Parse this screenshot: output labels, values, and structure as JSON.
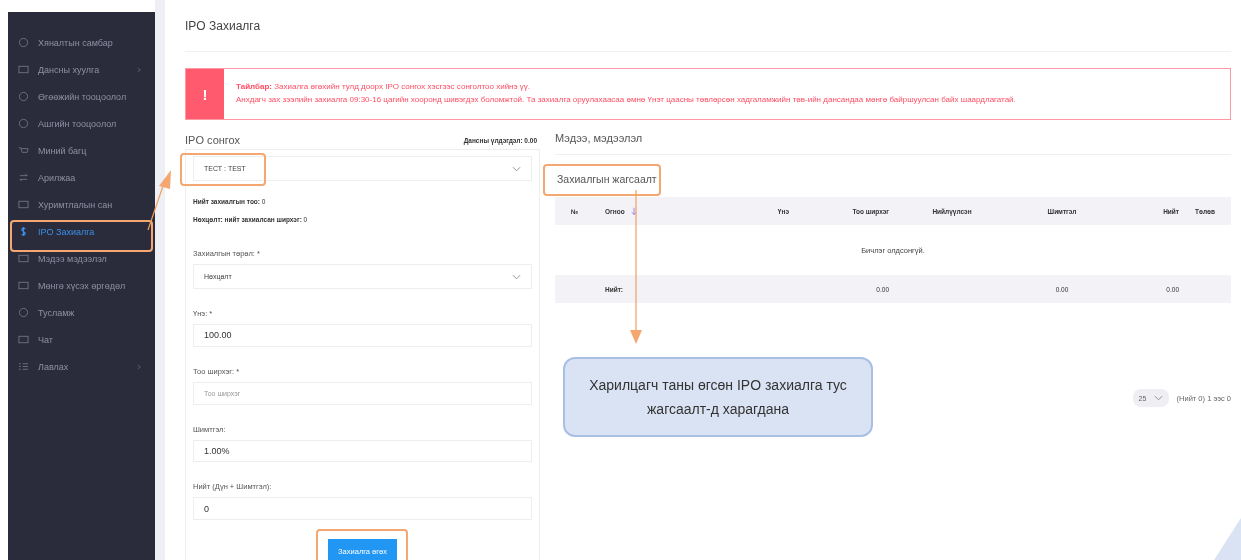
{
  "sidebar": {
    "items": [
      {
        "label": "Хяналтын самбар",
        "selected": false,
        "submenu": false
      },
      {
        "label": "Дансны хуулга",
        "selected": false,
        "submenu": true
      },
      {
        "label": "Өгөөжийн тооцоолол",
        "selected": false,
        "submenu": false
      },
      {
        "label": "Ашгийн тооцоолол",
        "selected": false,
        "submenu": false
      },
      {
        "label": "Миний багц",
        "selected": false,
        "submenu": false
      },
      {
        "label": "Арилжаа",
        "selected": false,
        "submenu": false
      },
      {
        "label": "Хуримтлалын сан",
        "selected": false,
        "submenu": false
      },
      {
        "label": "IPO Захиалга",
        "selected": true,
        "submenu": false
      },
      {
        "label": "Мэдээ мэдээлэл",
        "selected": false,
        "submenu": false
      },
      {
        "label": "Мөнгө хүсэх өргөдөл",
        "selected": false,
        "submenu": false
      },
      {
        "label": "Тусламж",
        "selected": false,
        "submenu": false
      },
      {
        "label": "Чат",
        "selected": false,
        "submenu": false
      },
      {
        "label": "Лавлах",
        "selected": false,
        "submenu": true
      }
    ]
  },
  "page_title": "IPO Захиалга",
  "alert": {
    "icon": "!",
    "lines": [
      "**Тайлбар:** Захиалга өгөхийн тулд доорх IPO сонгох хэсгээс сонголтоо хийнэ үү.",
      "Анхдагч зах зээлийн захиалга 09:30-16 цагийн хооронд шивэгдэх боломжтой. Та захиалга оруулахаасаа өмнө Үнэт цаасны төвлөрсөн хадгаламжийн төв-ийн дансандаа мөнгө байршуулсан байх шаардлагатай."
    ]
  },
  "ipo_panel": {
    "title": "IPO сонгох",
    "balance": "Дансны үлдэгдэл: 0.00",
    "ipo_select": "ТЕСТ : TEST",
    "stats": [
      "**Нийт захиалгын тоо:** 0",
      "**Нөхцөлт: нийт захиалсан ширхэг:** 0"
    ],
    "fields": [
      {
        "label": "Захиалгын төрөл: *",
        "kind": "select",
        "value": "Нөхцөлт"
      },
      {
        "label": "Үнэ: *",
        "kind": "input",
        "value": "100.00"
      },
      {
        "label": "Тоо ширхэг: *",
        "kind": "input",
        "placeholder": "Тоо ширхэг"
      },
      {
        "label": "Шимтгэл:",
        "kind": "input",
        "value": "1.00%"
      },
      {
        "label": "Нийт (Дүн + Шимтгэл):",
        "kind": "input",
        "value": "0"
      }
    ],
    "submit": "Захиалга өгөх"
  },
  "news_tab": "Мэдээ, мэдээлэл",
  "orders": {
    "title": "Захиалгын жагсаалт",
    "columns": [
      {
        "label": "№",
        "sorted": false
      },
      {
        "label": "Огноо",
        "sorted": true
      },
      {
        "label": "Үнэ",
        "sorted": false
      },
      {
        "label": "Тоо ширхэг",
        "sorted": false
      },
      {
        "label": "Нийлүүлсэн",
        "sorted": false
      },
      {
        "label": "Шимтгэл",
        "sorted": false
      },
      {
        "label": "Нийт",
        "sorted": false
      },
      {
        "label": "Төлөв",
        "sorted": false
      }
    ],
    "empty": "Бичлэг олдсонгүй.",
    "footer": {
      "label": "Нийт:",
      "qty_total": "0.00",
      "fee_total": "0.00",
      "grand_total": "0.00"
    },
    "page_size": "25",
    "page_info": "(Нийт 0) 1 ээс 0"
  },
  "callout": {
    "text": "Харилцагч таны өгсөн IPO захиалга тус жагсаалт-д харагдана"
  }
}
